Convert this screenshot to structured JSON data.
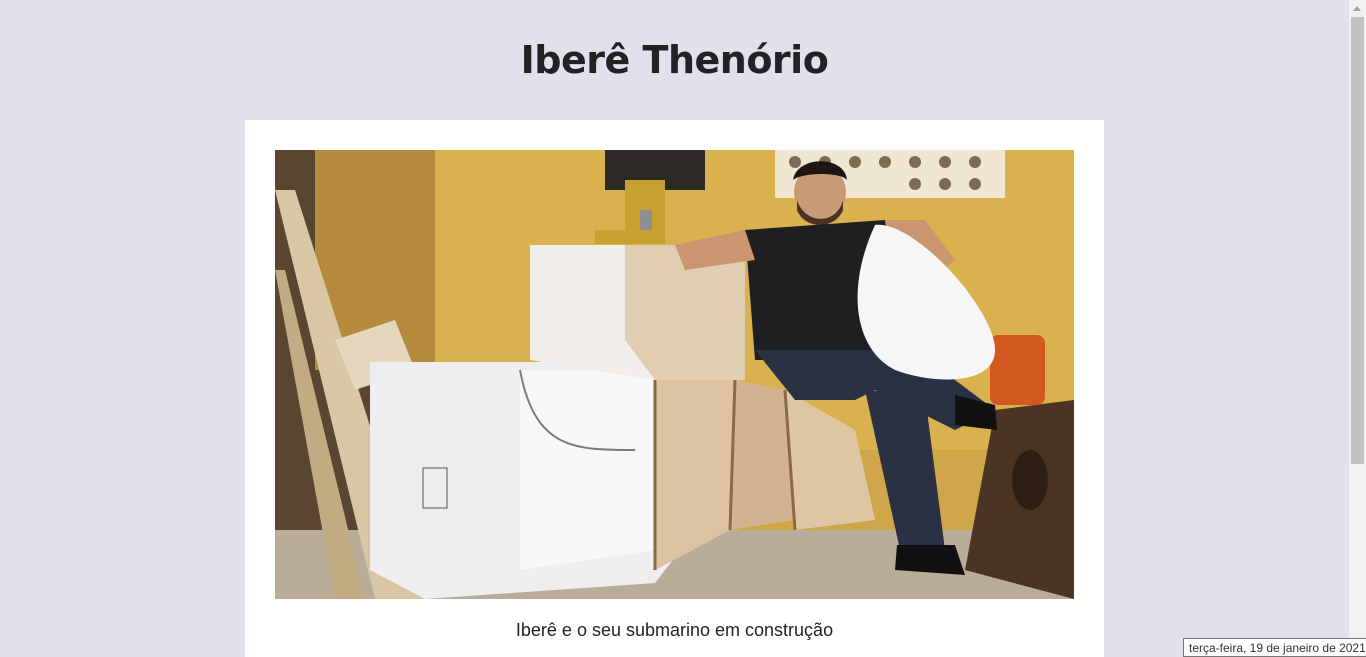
{
  "header": {
    "site_title": "Iberê Thenório"
  },
  "post": {
    "image_alt": "Iberê e o seu submarino em construção",
    "caption": "Iberê e o seu submarino em construção"
  },
  "tooltip": {
    "date": "terça-feira, 19 de janeiro de 2021"
  },
  "colors": {
    "page_background": "#e2e0ea",
    "card_background": "#ffffff",
    "title_text": "#222222"
  }
}
